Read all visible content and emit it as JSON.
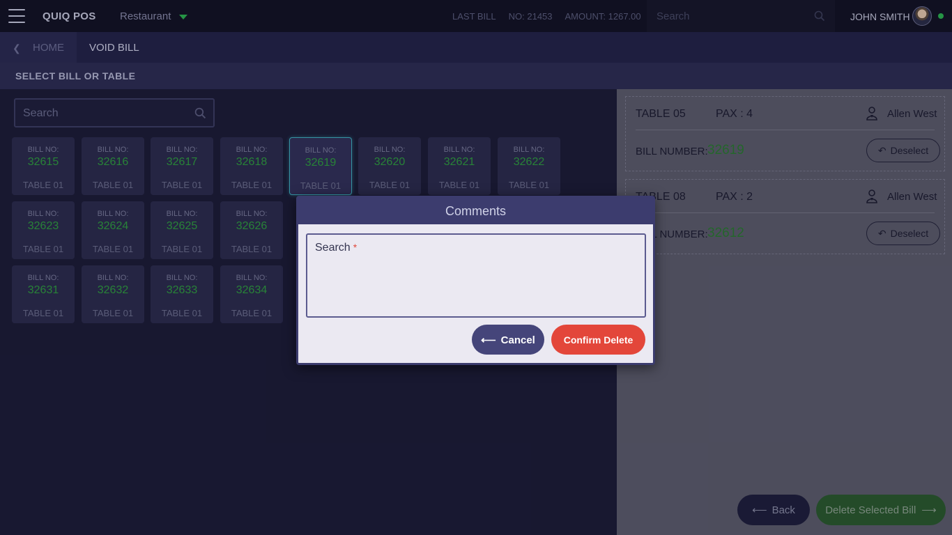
{
  "topbar": {
    "brand": "QUIQ POS",
    "outlet": "Restaurant",
    "last_bill_label": "LAST BILL",
    "last_bill_no": "NO: 21453",
    "last_bill_amount": "AMOUNT: 1267.00",
    "search_placeholder": "Search",
    "user_name": "JOHN SMITH",
    "status_color": "#2bb350"
  },
  "breadcrumb": {
    "home": "HOME",
    "current": "VOID BILL"
  },
  "section_header": "SELECT BILL OR TABLE",
  "bill_search_placeholder": "Search",
  "bills": [
    {
      "label": "BILL NO:",
      "number": "32615",
      "table": "TABLE 01"
    },
    {
      "label": "BILL NO:",
      "number": "32616",
      "table": "TABLE 01"
    },
    {
      "label": "BILL NO:",
      "number": "32617",
      "table": "TABLE 01"
    },
    {
      "label": "BILL NO:",
      "number": "32618",
      "table": "TABLE 01"
    },
    {
      "label": "BILL NO:",
      "number": "32619",
      "table": "TABLE 01",
      "selected": true
    },
    {
      "label": "BILL NO:",
      "number": "32620",
      "table": "TABLE 01"
    },
    {
      "label": "BILL NO:",
      "number": "32621",
      "table": "TABLE 01"
    },
    {
      "label": "BILL NO:",
      "number": "32622",
      "table": "TABLE 01"
    },
    {
      "label": "BILL NO:",
      "number": "32623",
      "table": "TABLE 01"
    },
    {
      "label": "BILL NO:",
      "number": "32624",
      "table": "TABLE 01"
    },
    {
      "label": "BILL NO:",
      "number": "32625",
      "table": "TABLE 01"
    },
    {
      "label": "BILL NO:",
      "number": "32626",
      "table": "TABLE 01"
    },
    {
      "label": "BILL NO:",
      "number": "32631",
      "table": "TABLE 01"
    },
    {
      "label": "BILL NO:",
      "number": "32632",
      "table": "TABLE 01"
    },
    {
      "label": "BILL NO:",
      "number": "32633",
      "table": "TABLE 01"
    },
    {
      "label": "BILL NO:",
      "number": "32634",
      "table": "TABLE 01"
    }
  ],
  "selected_bills": [
    {
      "table": "TABLE 05",
      "pax": "PAX : 4",
      "waiter": "Allen West",
      "bill_label": "BILL NUMBER:",
      "bill_number": "32619",
      "deselect": "Deselect"
    },
    {
      "table": "TABLE 08",
      "pax": "PAX : 2",
      "waiter": "Allen West",
      "bill_label": "BILL NUMBER:",
      "bill_number": "32612",
      "deselect": "Deselect"
    }
  ],
  "actions": {
    "back": "Back",
    "delete_selected": "Delete Selected Bill"
  },
  "modal": {
    "title": "Comments",
    "field_label": "Search",
    "required_mark": "*",
    "cancel": "Cancel",
    "confirm": "Confirm Delete"
  }
}
